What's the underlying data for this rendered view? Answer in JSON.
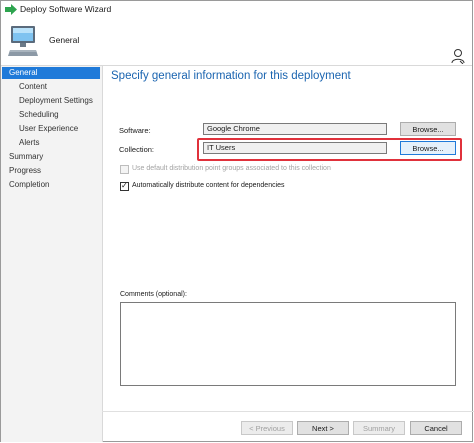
{
  "window": {
    "title": "Deploy Software Wizard"
  },
  "header": {
    "title": "General"
  },
  "nav": {
    "items": [
      {
        "label": "General",
        "selected": true,
        "level": 1
      },
      {
        "label": "Content",
        "selected": false,
        "level": 2
      },
      {
        "label": "Deployment Settings",
        "selected": false,
        "level": 2
      },
      {
        "label": "Scheduling",
        "selected": false,
        "level": 2
      },
      {
        "label": "User Experience",
        "selected": false,
        "level": 2
      },
      {
        "label": "Alerts",
        "selected": false,
        "level": 2
      },
      {
        "label": "Summary",
        "selected": false,
        "level": 1
      },
      {
        "label": "Progress",
        "selected": false,
        "level": 1
      },
      {
        "label": "Completion",
        "selected": false,
        "level": 1
      }
    ]
  },
  "main": {
    "heading": "Specify general information for this deployment",
    "software": {
      "label": "Software:",
      "value": "Google Chrome",
      "browse_label": "Browse..."
    },
    "collection": {
      "label": "Collection:",
      "value": "IT Users",
      "browse_label": "Browse..."
    },
    "use_default_groups": {
      "label": "Use default distribution point groups associated to this collection",
      "checked": false,
      "enabled": false
    },
    "auto_distribute": {
      "label": "Automatically distribute content for dependencies",
      "checked": true,
      "enabled": true
    },
    "comments": {
      "label": "Comments (optional):",
      "value": ""
    }
  },
  "footer": {
    "previous_label": "< Previous",
    "next_label": "Next >",
    "summary_label": "Summary",
    "cancel_label": "Cancel"
  },
  "colors": {
    "accent": "#1f7ad9",
    "highlight": "#e0313b",
    "heading": "#1a64b0"
  },
  "icons": {
    "title": "green-arrow-icon",
    "header": "computer-icon",
    "user": "user-icon"
  }
}
